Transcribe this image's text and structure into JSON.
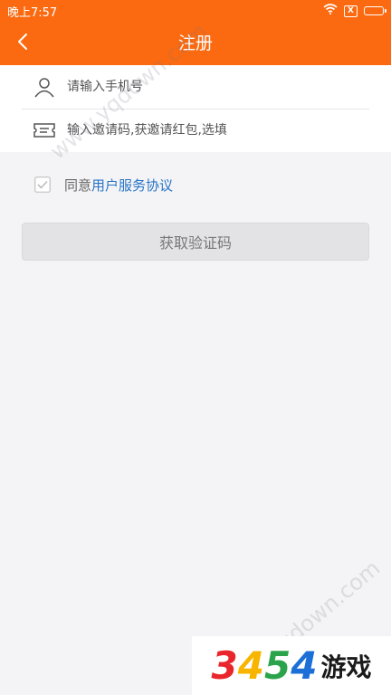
{
  "status_bar": {
    "time": "晚上7:57",
    "sim_label": "X"
  },
  "header": {
    "title": "注册",
    "back_icon": "chevron-left-icon"
  },
  "form": {
    "phone": {
      "icon": "person-icon",
      "placeholder": "请输入手机号",
      "value": ""
    },
    "invite": {
      "icon": "ticket-icon",
      "placeholder": "输入邀请码,获邀请红包,选填",
      "value": ""
    }
  },
  "agreement": {
    "checked": true,
    "prefix": "同意",
    "link": "用户服务协议"
  },
  "actions": {
    "get_code": "获取验证码"
  },
  "watermarks": {
    "top": "www.yqdown.com",
    "bottom": "yqdown.com"
  },
  "logo": {
    "digits": [
      "3",
      "4",
      "5",
      "4"
    ],
    "word": "游戏",
    "colors": [
      "#e8262b",
      "#f7b500",
      "#2aa34a",
      "#1d6fd8"
    ]
  },
  "colors": {
    "accent": "#fb6a10",
    "link": "#2774c6"
  }
}
